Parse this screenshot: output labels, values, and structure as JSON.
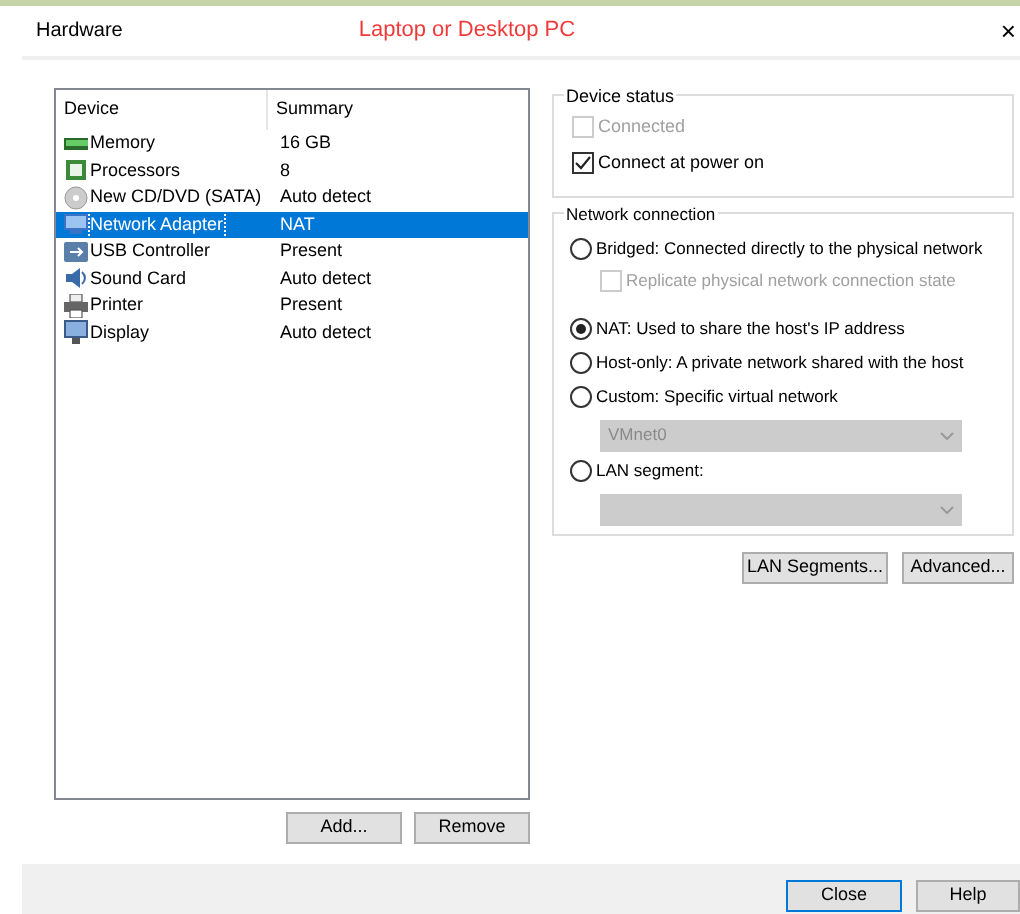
{
  "window": {
    "title": "Hardware",
    "annotation": "Laptop or Desktop PC",
    "close": "×"
  },
  "devices": {
    "columns": [
      "Device",
      "Summary"
    ],
    "rows": [
      {
        "kind": "memory",
        "device": "Memory",
        "summary": "16 GB",
        "selected": false
      },
      {
        "kind": "processor",
        "device": "Processors",
        "summary": "8",
        "selected": false
      },
      {
        "kind": "cd",
        "device": "New CD/DVD (SATA)",
        "summary": "Auto detect",
        "selected": false
      },
      {
        "kind": "network",
        "device": "Network Adapter",
        "summary": "NAT",
        "selected": true
      },
      {
        "kind": "usb",
        "device": "USB Controller",
        "summary": "Present",
        "selected": false
      },
      {
        "kind": "sound",
        "device": "Sound Card",
        "summary": "Auto detect",
        "selected": false
      },
      {
        "kind": "printer",
        "device": "Printer",
        "summary": "Present",
        "selected": false
      },
      {
        "kind": "display",
        "device": "Display",
        "summary": "Auto detect",
        "selected": false
      }
    ],
    "buttons": [
      "Add...",
      "Remove"
    ]
  },
  "device_status": {
    "title": "Device status",
    "options": [
      {
        "label": "Connected",
        "checked": false,
        "disabled": true
      },
      {
        "label": "Connect at power on",
        "checked": true,
        "disabled": false
      }
    ]
  },
  "network_connection": {
    "title": "Network connection",
    "items": [
      {
        "kind": "radio",
        "label": "Bridged: Connected directly to the physical network",
        "selected": false
      },
      {
        "kind": "checkbox",
        "label": "Replicate physical network connection state",
        "checked": false,
        "disabled": true
      },
      {
        "kind": "radio",
        "label": "NAT: Used to share the host's IP address",
        "selected": true
      },
      {
        "kind": "radio",
        "label": "Host-only: A private network shared with the host",
        "selected": false
      },
      {
        "kind": "radio",
        "label": "Custom: Specific virtual network",
        "selected": false
      },
      {
        "kind": "dropdown",
        "value": "VMnet0",
        "disabled": true
      },
      {
        "kind": "radio",
        "label": "LAN segment:",
        "selected": false
      },
      {
        "kind": "dropdown",
        "disabled": true
      }
    ],
    "buttons": [
      "LAN Segments...",
      "Advanced..."
    ]
  },
  "footer_buttons": [
    "Close",
    "Help"
  ]
}
